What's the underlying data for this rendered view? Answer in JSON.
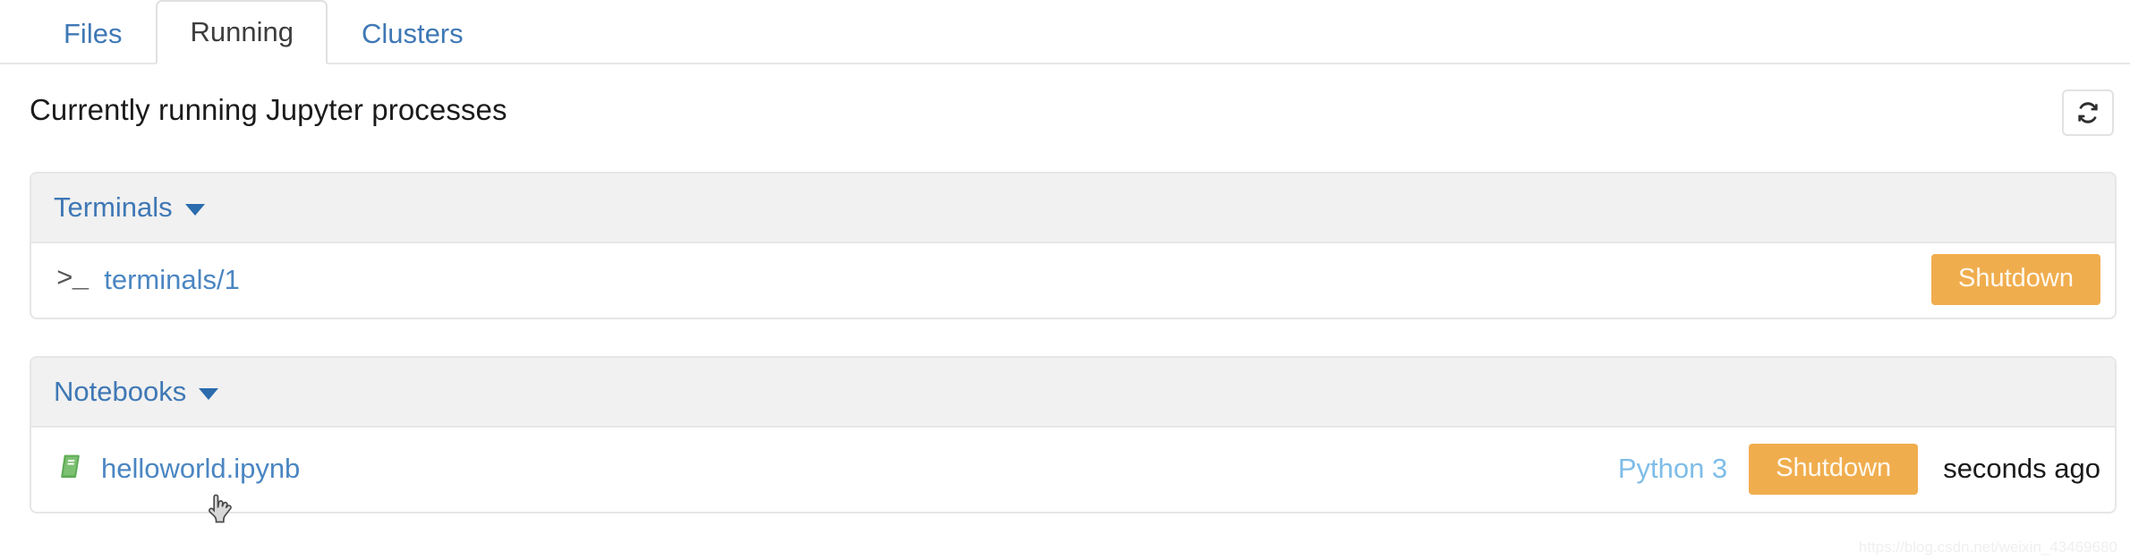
{
  "tabs": [
    {
      "label": "Files",
      "active": false
    },
    {
      "label": "Running",
      "active": true
    },
    {
      "label": "Clusters",
      "active": false
    }
  ],
  "header": {
    "title": "Currently running Jupyter processes",
    "refresh_icon": "refresh-icon"
  },
  "sections": {
    "terminals": {
      "title": "Terminals",
      "caret_icon": "caret-down-icon",
      "rows": [
        {
          "icon": "terminal-prompt-icon",
          "icon_glyph": ">_",
          "name": "terminals/1",
          "shutdown_label": "Shutdown"
        }
      ]
    },
    "notebooks": {
      "title": "Notebooks",
      "caret_icon": "caret-down-icon",
      "rows": [
        {
          "icon": "notebook-book-icon",
          "name": "helloworld.ipynb",
          "kernel": "Python 3",
          "shutdown_label": "Shutdown",
          "last_activity": "seconds ago"
        }
      ]
    }
  },
  "watermark": "https://blog.csdn.net/weixin_43469680",
  "colors": {
    "link_blue": "#4b86c2",
    "tab_blue": "#3f78b5",
    "shutdown_orange": "#f0ad4e",
    "panel_header_gray": "#f1f1f1",
    "border_gray": "#e6e6e6",
    "kernel_blue": "#7fbde8",
    "notebook_green": "#5cab53"
  }
}
